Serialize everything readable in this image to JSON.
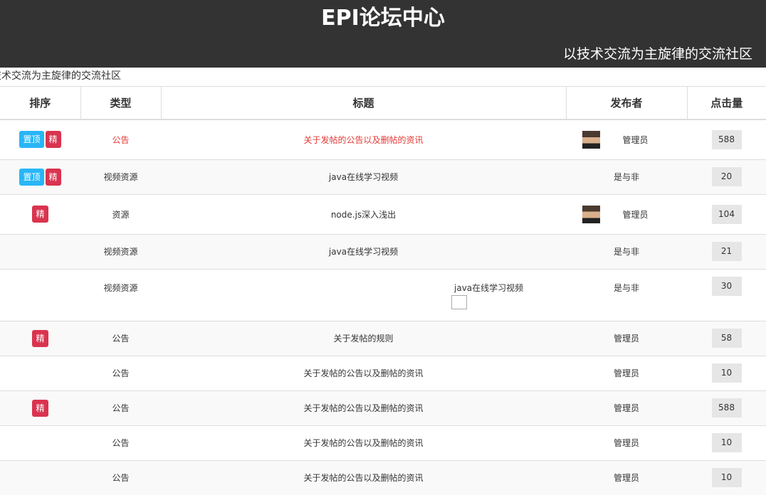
{
  "header": {
    "title": "EPI论坛中心",
    "subtitle": "以技术交流为主旋律的交流社区"
  },
  "marquee": "技术交流为主旋律的交流社区",
  "table": {
    "headers": [
      "排序",
      "类型",
      "标题",
      "发布者",
      "点击量"
    ],
    "badges": {
      "top": "置顶",
      "elite": "精"
    },
    "rows": [
      {
        "type": "公告",
        "title": "关于发帖的公告以及删帖的资讯",
        "author": "管理员",
        "clicks": "588"
      },
      {
        "type": "视频资源",
        "title": "java在线学习视频",
        "author": "是与非",
        "clicks": "20"
      },
      {
        "type": "资源",
        "title": "node.js深入浅出",
        "author": "管理员",
        "clicks": "104"
      },
      {
        "type": "视频资源",
        "title": "java在线学习视频",
        "author": "是与非",
        "clicks": "21"
      },
      {
        "type": "视频资源",
        "title": "java在线学习视频",
        "author": "是与非",
        "clicks": "30"
      },
      {
        "type": "公告",
        "title": "关于发帖的规则",
        "author": "管理员",
        "clicks": "58"
      },
      {
        "type": "公告",
        "title": "关于发帖的公告以及删帖的资讯",
        "author": "管理员",
        "clicks": "10"
      },
      {
        "type": "公告",
        "title": "关于发帖的公告以及删帖的资讯",
        "author": "管理员",
        "clicks": "588"
      },
      {
        "type": "公告",
        "title": "关于发帖的公告以及删帖的资讯",
        "author": "管理员",
        "clicks": "10"
      },
      {
        "type": "公告",
        "title": "关于发帖的公告以及删帖的资讯",
        "author": "管理员",
        "clicks": "10"
      }
    ]
  },
  "colors": {
    "header_bg": "#333333",
    "badge_top": "#29b6f6",
    "badge_elite": "#d9344f",
    "highlight_text": "#e53935"
  }
}
